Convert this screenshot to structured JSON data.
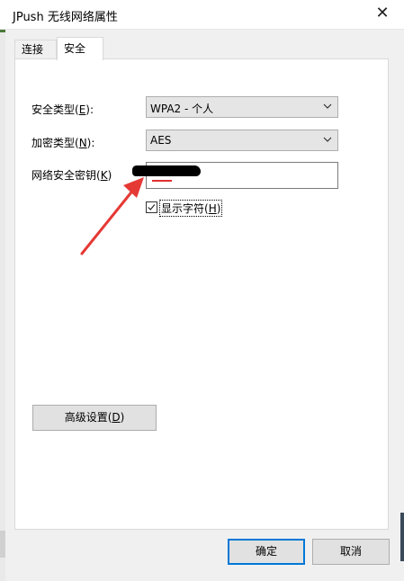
{
  "window": {
    "title": "JPush 无线网络属性",
    "close_label": "✕"
  },
  "tabs": [
    {
      "label": "连接",
      "active": false
    },
    {
      "label": "安全",
      "active": true
    }
  ],
  "security": {
    "security_type": {
      "label_main": "安全类型(",
      "label_key": "E",
      "label_end": "):",
      "value": "WPA2 - 个人"
    },
    "encryption_type": {
      "label_main": "加密类型(",
      "label_key": "N",
      "label_end": "):",
      "value": "AES"
    },
    "network_key": {
      "label_main": "网络安全密钥(",
      "label_key": "K",
      "label_end": ")",
      "value": ""
    },
    "show_chars": {
      "label_main": "显示字符(",
      "label_key": "H",
      "label_end": ")",
      "checked": true
    },
    "advanced_button": {
      "label_main": "高级设置(",
      "label_key": "D",
      "label_end": ")"
    }
  },
  "buttons": {
    "ok": "确定",
    "cancel": "取消"
  },
  "colors": {
    "focus_border": "#0078d7",
    "annotation_arrow": "#e53935"
  },
  "icons": {
    "dropdown": "chevron-down-icon",
    "checkbox": "checkmark-icon",
    "close": "close-icon"
  }
}
